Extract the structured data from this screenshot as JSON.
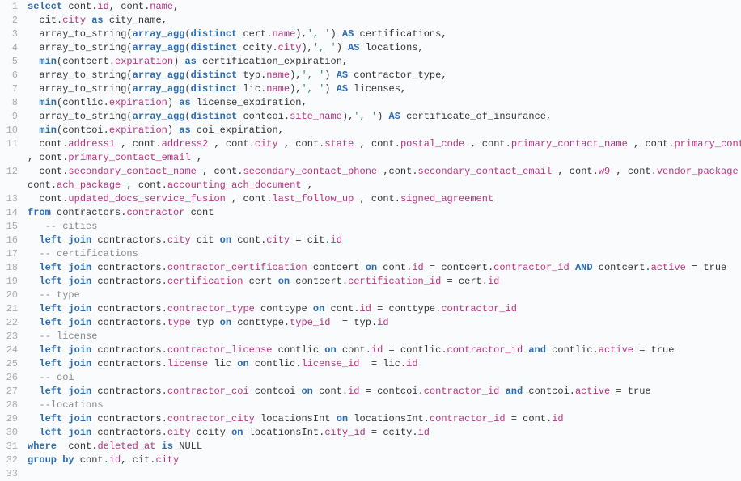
{
  "line_numbers": [
    "1",
    "2",
    "3",
    "4",
    "5",
    "6",
    "7",
    "8",
    "9",
    "10",
    "11",
    "",
    "12",
    "",
    "13",
    "14",
    "15",
    "16",
    "17",
    "18",
    "19",
    "20",
    "21",
    "22",
    "23",
    "24",
    "25",
    "26",
    "27",
    "28",
    "29",
    "30",
    "31",
    "32",
    "33"
  ],
  "tokens": [
    [
      [
        "cursor",
        ""
      ],
      [
        "kw",
        "select"
      ],
      [
        "id",
        " cont"
      ],
      [
        "punc",
        "."
      ],
      [
        "prop",
        "id"
      ],
      [
        "punc",
        ", cont"
      ],
      [
        "punc",
        "."
      ],
      [
        "prop",
        "name"
      ],
      [
        "punc",
        ","
      ]
    ],
    [
      [
        "id",
        "  cit"
      ],
      [
        "punc",
        "."
      ],
      [
        "prop",
        "city"
      ],
      [
        "id",
        " "
      ],
      [
        "kw",
        "as"
      ],
      [
        "id",
        " city_name,"
      ]
    ],
    [
      [
        "id",
        "  array_to_string("
      ],
      [
        "fn",
        "array_agg"
      ],
      [
        "punc",
        "("
      ],
      [
        "kw",
        "distinct"
      ],
      [
        "id",
        " cert"
      ],
      [
        "punc",
        "."
      ],
      [
        "prop",
        "name"
      ],
      [
        "punc",
        "),"
      ],
      [
        "str",
        "', '"
      ],
      [
        "punc",
        ") "
      ],
      [
        "kw",
        "AS"
      ],
      [
        "id",
        " certifications,"
      ]
    ],
    [
      [
        "id",
        "  array_to_string("
      ],
      [
        "fn",
        "array_agg"
      ],
      [
        "punc",
        "("
      ],
      [
        "kw",
        "distinct"
      ],
      [
        "id",
        " ccity"
      ],
      [
        "punc",
        "."
      ],
      [
        "prop",
        "city"
      ],
      [
        "punc",
        "),"
      ],
      [
        "str",
        "', '"
      ],
      [
        "punc",
        ") "
      ],
      [
        "kw",
        "AS"
      ],
      [
        "id",
        " locations,"
      ]
    ],
    [
      [
        "id",
        "  "
      ],
      [
        "fn",
        "min"
      ],
      [
        "punc",
        "(contcert"
      ],
      [
        "punc",
        "."
      ],
      [
        "prop",
        "expiration"
      ],
      [
        "punc",
        ") "
      ],
      [
        "kw",
        "as"
      ],
      [
        "id",
        " certification_expiration,"
      ]
    ],
    [
      [
        "id",
        "  array_to_string("
      ],
      [
        "fn",
        "array_agg"
      ],
      [
        "punc",
        "("
      ],
      [
        "kw",
        "distinct"
      ],
      [
        "id",
        " typ"
      ],
      [
        "punc",
        "."
      ],
      [
        "prop",
        "name"
      ],
      [
        "punc",
        "),"
      ],
      [
        "str",
        "', '"
      ],
      [
        "punc",
        ") "
      ],
      [
        "kw",
        "AS"
      ],
      [
        "id",
        " contractor_type,"
      ]
    ],
    [
      [
        "id",
        "  array_to_string("
      ],
      [
        "fn",
        "array_agg"
      ],
      [
        "punc",
        "("
      ],
      [
        "kw",
        "distinct"
      ],
      [
        "id",
        " lic"
      ],
      [
        "punc",
        "."
      ],
      [
        "prop",
        "name"
      ],
      [
        "punc",
        "),"
      ],
      [
        "str",
        "', '"
      ],
      [
        "punc",
        ") "
      ],
      [
        "kw",
        "AS"
      ],
      [
        "id",
        " licenses,"
      ]
    ],
    [
      [
        "id",
        "  "
      ],
      [
        "fn",
        "min"
      ],
      [
        "punc",
        "(contlic"
      ],
      [
        "punc",
        "."
      ],
      [
        "prop",
        "expiration"
      ],
      [
        "punc",
        ") "
      ],
      [
        "kw",
        "as"
      ],
      [
        "id",
        " license_expiration,"
      ]
    ],
    [
      [
        "id",
        "  array_to_string("
      ],
      [
        "fn",
        "array_agg"
      ],
      [
        "punc",
        "("
      ],
      [
        "kw",
        "distinct"
      ],
      [
        "id",
        " contcoi"
      ],
      [
        "punc",
        "."
      ],
      [
        "prop",
        "site_name"
      ],
      [
        "punc",
        "),"
      ],
      [
        "str",
        "', '"
      ],
      [
        "punc",
        ") "
      ],
      [
        "kw",
        "AS"
      ],
      [
        "id",
        " certificate_of_insurance,"
      ]
    ],
    [
      [
        "id",
        "  "
      ],
      [
        "fn",
        "min"
      ],
      [
        "punc",
        "(contcoi"
      ],
      [
        "punc",
        "."
      ],
      [
        "prop",
        "expiration"
      ],
      [
        "punc",
        ") "
      ],
      [
        "kw",
        "as"
      ],
      [
        "id",
        " coi_expiration,"
      ]
    ],
    [
      [
        "id",
        "  cont"
      ],
      [
        "punc",
        "."
      ],
      [
        "prop",
        "address1"
      ],
      [
        "id",
        " , cont"
      ],
      [
        "punc",
        "."
      ],
      [
        "prop",
        "address2"
      ],
      [
        "id",
        " , cont"
      ],
      [
        "punc",
        "."
      ],
      [
        "prop",
        "city"
      ],
      [
        "id",
        " , cont"
      ],
      [
        "punc",
        "."
      ],
      [
        "prop",
        "state"
      ],
      [
        "id",
        " , cont"
      ],
      [
        "punc",
        "."
      ],
      [
        "prop",
        "postal_code"
      ],
      [
        "id",
        " , cont"
      ],
      [
        "punc",
        "."
      ],
      [
        "prop",
        "primary_contact_name"
      ],
      [
        "id",
        " , cont"
      ],
      [
        "punc",
        "."
      ],
      [
        "prop",
        "primary_contact_phone"
      ]
    ],
    [
      [
        "id",
        ", cont"
      ],
      [
        "punc",
        "."
      ],
      [
        "prop",
        "primary_contact_email"
      ],
      [
        "id",
        " ,"
      ]
    ],
    [
      [
        "id",
        "  cont"
      ],
      [
        "punc",
        "."
      ],
      [
        "prop",
        "secondary_contact_name"
      ],
      [
        "id",
        " , cont"
      ],
      [
        "punc",
        "."
      ],
      [
        "prop",
        "secondary_contact_phone"
      ],
      [
        "id",
        " ,cont"
      ],
      [
        "punc",
        "."
      ],
      [
        "prop",
        "secondary_contact_email"
      ],
      [
        "id",
        " , cont"
      ],
      [
        "punc",
        "."
      ],
      [
        "prop",
        "w9"
      ],
      [
        "id",
        " , cont"
      ],
      [
        "punc",
        "."
      ],
      [
        "prop",
        "vendor_package"
      ],
      [
        "id",
        " ,"
      ]
    ],
    [
      [
        "id",
        "cont"
      ],
      [
        "punc",
        "."
      ],
      [
        "prop",
        "ach_package"
      ],
      [
        "id",
        " , cont"
      ],
      [
        "punc",
        "."
      ],
      [
        "prop",
        "accounting_ach_document"
      ],
      [
        "id",
        " ,"
      ]
    ],
    [
      [
        "id",
        "  cont"
      ],
      [
        "punc",
        "."
      ],
      [
        "prop",
        "updated_docs_service_fusion"
      ],
      [
        "id",
        " , cont"
      ],
      [
        "punc",
        "."
      ],
      [
        "prop",
        "last_follow_up"
      ],
      [
        "id",
        " , cont"
      ],
      [
        "punc",
        "."
      ],
      [
        "prop",
        "signed_agreement"
      ]
    ],
    [
      [
        "kw",
        "from"
      ],
      [
        "id",
        " contractors"
      ],
      [
        "punc",
        "."
      ],
      [
        "prop",
        "contractor"
      ],
      [
        "id",
        " cont"
      ]
    ],
    [
      [
        "id",
        "   "
      ],
      [
        "cmt",
        "-- cities"
      ]
    ],
    [
      [
        "id",
        "  "
      ],
      [
        "kw",
        "left join"
      ],
      [
        "id",
        " contractors"
      ],
      [
        "punc",
        "."
      ],
      [
        "prop",
        "city"
      ],
      [
        "id",
        " cit "
      ],
      [
        "kw",
        "on"
      ],
      [
        "id",
        " cont"
      ],
      [
        "punc",
        "."
      ],
      [
        "prop",
        "city"
      ],
      [
        "id",
        " = cit"
      ],
      [
        "punc",
        "."
      ],
      [
        "prop",
        "id"
      ]
    ],
    [
      [
        "id",
        "  "
      ],
      [
        "cmt",
        "-- certifications"
      ]
    ],
    [
      [
        "id",
        "  "
      ],
      [
        "kw",
        "left join"
      ],
      [
        "id",
        " contractors"
      ],
      [
        "punc",
        "."
      ],
      [
        "prop",
        "contractor_certification"
      ],
      [
        "id",
        " contcert "
      ],
      [
        "kw",
        "on"
      ],
      [
        "id",
        " cont"
      ],
      [
        "punc",
        "."
      ],
      [
        "prop",
        "id"
      ],
      [
        "id",
        " = contcert"
      ],
      [
        "punc",
        "."
      ],
      [
        "prop",
        "contractor_id"
      ],
      [
        "id",
        " "
      ],
      [
        "kw",
        "AND"
      ],
      [
        "id",
        " contcert"
      ],
      [
        "punc",
        "."
      ],
      [
        "prop",
        "active"
      ],
      [
        "id",
        " = true"
      ]
    ],
    [
      [
        "id",
        "  "
      ],
      [
        "kw",
        "left join"
      ],
      [
        "id",
        " contractors"
      ],
      [
        "punc",
        "."
      ],
      [
        "prop",
        "certification"
      ],
      [
        "id",
        " cert "
      ],
      [
        "kw",
        "on"
      ],
      [
        "id",
        " contcert"
      ],
      [
        "punc",
        "."
      ],
      [
        "prop",
        "certification_id"
      ],
      [
        "id",
        " = cert"
      ],
      [
        "punc",
        "."
      ],
      [
        "prop",
        "id"
      ]
    ],
    [
      [
        "id",
        "  "
      ],
      [
        "cmt",
        "-- type"
      ]
    ],
    [
      [
        "id",
        "  "
      ],
      [
        "kw",
        "left join"
      ],
      [
        "id",
        " contractors"
      ],
      [
        "punc",
        "."
      ],
      [
        "prop",
        "contractor_type"
      ],
      [
        "id",
        " conttype "
      ],
      [
        "kw",
        "on"
      ],
      [
        "id",
        " cont"
      ],
      [
        "punc",
        "."
      ],
      [
        "prop",
        "id"
      ],
      [
        "id",
        " = conttype"
      ],
      [
        "punc",
        "."
      ],
      [
        "prop",
        "contractor_id"
      ]
    ],
    [
      [
        "id",
        "  "
      ],
      [
        "kw",
        "left join"
      ],
      [
        "id",
        " contractors"
      ],
      [
        "punc",
        "."
      ],
      [
        "prop",
        "type"
      ],
      [
        "id",
        " typ "
      ],
      [
        "kw",
        "on"
      ],
      [
        "id",
        " conttype"
      ],
      [
        "punc",
        "."
      ],
      [
        "prop",
        "type_id"
      ],
      [
        "id",
        "  = typ"
      ],
      [
        "punc",
        "."
      ],
      [
        "prop",
        "id"
      ]
    ],
    [
      [
        "id",
        "  "
      ],
      [
        "cmt",
        "-- license"
      ]
    ],
    [
      [
        "id",
        "  "
      ],
      [
        "kw",
        "left join"
      ],
      [
        "id",
        " contractors"
      ],
      [
        "punc",
        "."
      ],
      [
        "prop",
        "contractor_license"
      ],
      [
        "id",
        " contlic "
      ],
      [
        "kw",
        "on"
      ],
      [
        "id",
        " cont"
      ],
      [
        "punc",
        "."
      ],
      [
        "prop",
        "id"
      ],
      [
        "id",
        " = contlic"
      ],
      [
        "punc",
        "."
      ],
      [
        "prop",
        "contractor_id"
      ],
      [
        "id",
        " "
      ],
      [
        "kw",
        "and"
      ],
      [
        "id",
        " contlic"
      ],
      [
        "punc",
        "."
      ],
      [
        "prop",
        "active"
      ],
      [
        "id",
        " = true"
      ]
    ],
    [
      [
        "id",
        "  "
      ],
      [
        "kw",
        "left join"
      ],
      [
        "id",
        " contractors"
      ],
      [
        "punc",
        "."
      ],
      [
        "prop",
        "license"
      ],
      [
        "id",
        " lic "
      ],
      [
        "kw",
        "on"
      ],
      [
        "id",
        " contlic"
      ],
      [
        "punc",
        "."
      ],
      [
        "prop",
        "license_id"
      ],
      [
        "id",
        "  = lic"
      ],
      [
        "punc",
        "."
      ],
      [
        "prop",
        "id"
      ]
    ],
    [
      [
        "id",
        "  "
      ],
      [
        "cmt",
        "-- coi"
      ]
    ],
    [
      [
        "id",
        "  "
      ],
      [
        "kw",
        "left join"
      ],
      [
        "id",
        " contractors"
      ],
      [
        "punc",
        "."
      ],
      [
        "prop",
        "contractor_coi"
      ],
      [
        "id",
        " contcoi "
      ],
      [
        "kw",
        "on"
      ],
      [
        "id",
        " cont"
      ],
      [
        "punc",
        "."
      ],
      [
        "prop",
        "id"
      ],
      [
        "id",
        " = contcoi"
      ],
      [
        "punc",
        "."
      ],
      [
        "prop",
        "contractor_id"
      ],
      [
        "id",
        " "
      ],
      [
        "kw",
        "and"
      ],
      [
        "id",
        " contcoi"
      ],
      [
        "punc",
        "."
      ],
      [
        "prop",
        "active"
      ],
      [
        "id",
        " = true"
      ]
    ],
    [
      [
        "id",
        "  "
      ],
      [
        "cmt",
        "--locations"
      ]
    ],
    [
      [
        "id",
        "  "
      ],
      [
        "kw",
        "left join"
      ],
      [
        "id",
        " contractors"
      ],
      [
        "punc",
        "."
      ],
      [
        "prop",
        "contractor_city"
      ],
      [
        "id",
        " locationsInt "
      ],
      [
        "kw",
        "on"
      ],
      [
        "id",
        " locationsInt"
      ],
      [
        "punc",
        "."
      ],
      [
        "prop",
        "contractor_id"
      ],
      [
        "id",
        " = cont"
      ],
      [
        "punc",
        "."
      ],
      [
        "prop",
        "id"
      ]
    ],
    [
      [
        "id",
        "  "
      ],
      [
        "kw",
        "left join"
      ],
      [
        "id",
        " contractors"
      ],
      [
        "punc",
        "."
      ],
      [
        "prop",
        "city"
      ],
      [
        "id",
        " ccity "
      ],
      [
        "kw",
        "on"
      ],
      [
        "id",
        " locationsInt"
      ],
      [
        "punc",
        "."
      ],
      [
        "prop",
        "city_id"
      ],
      [
        "id",
        " = ccity"
      ],
      [
        "punc",
        "."
      ],
      [
        "prop",
        "id"
      ]
    ],
    [
      [
        "kw",
        "where"
      ],
      [
        "id",
        "  cont"
      ],
      [
        "punc",
        "."
      ],
      [
        "prop",
        "deleted_at"
      ],
      [
        "id",
        " "
      ],
      [
        "kw",
        "is"
      ],
      [
        "id",
        " NULL"
      ]
    ],
    [
      [
        "kw",
        "group by"
      ],
      [
        "id",
        " cont"
      ],
      [
        "punc",
        "."
      ],
      [
        "prop",
        "id"
      ],
      [
        "id",
        ", cit"
      ],
      [
        "punc",
        "."
      ],
      [
        "prop",
        "city"
      ]
    ],
    [
      [
        "id",
        ""
      ]
    ]
  ]
}
